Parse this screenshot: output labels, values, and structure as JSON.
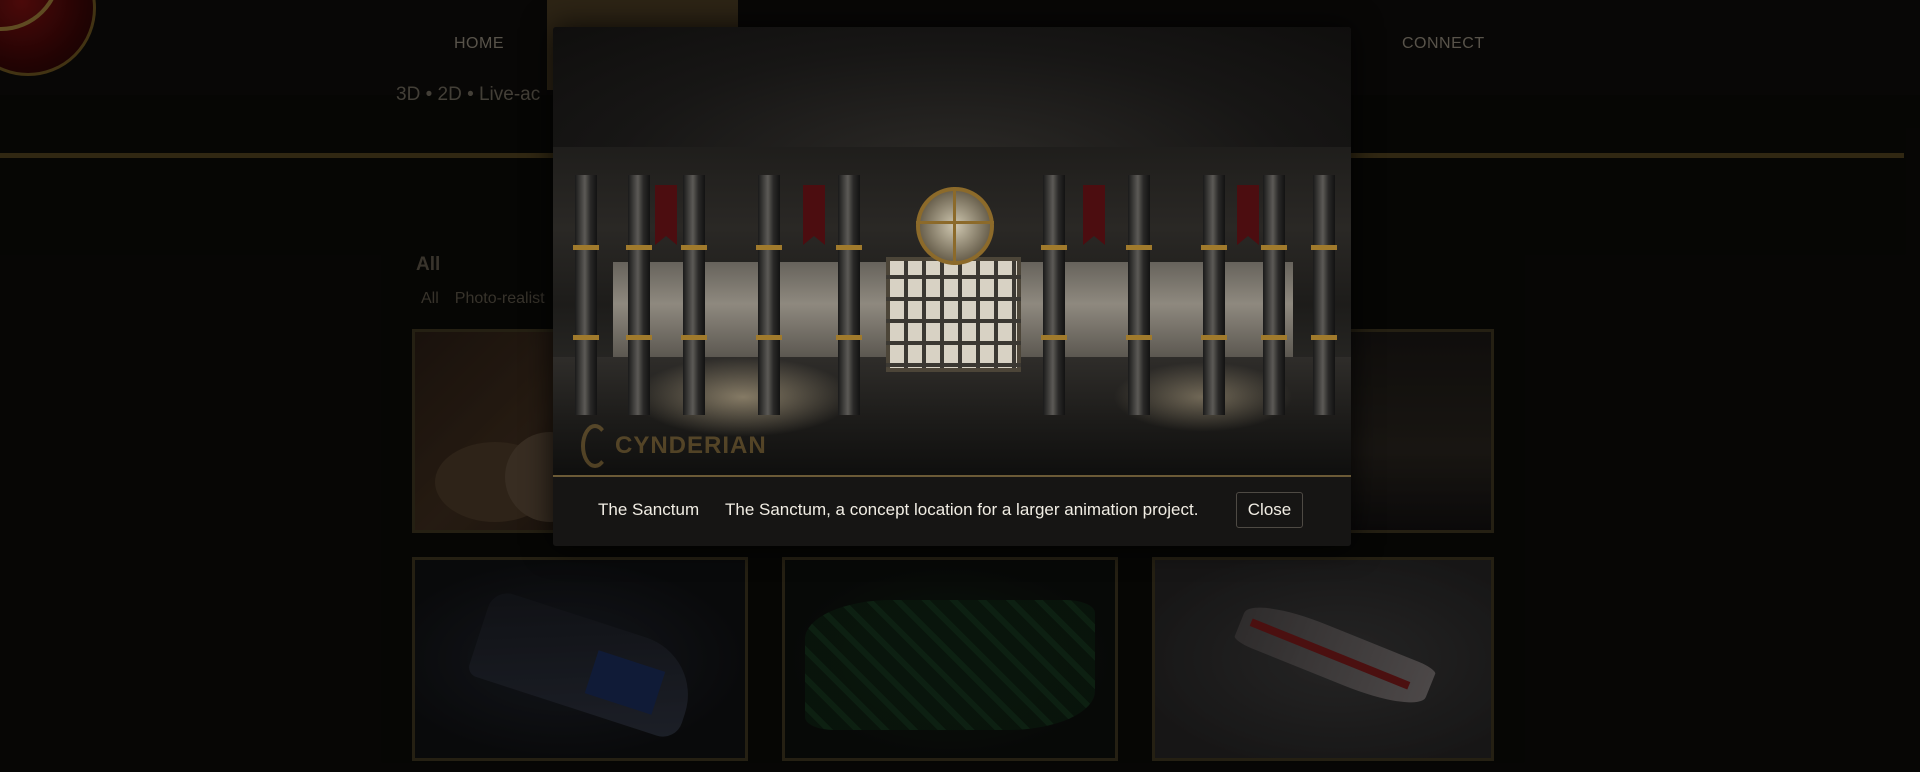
{
  "nav": {
    "home": "HOME",
    "connect": "CONNECT"
  },
  "tagline": "3D • 2D • Live-ac",
  "filters": {
    "heading": "All",
    "items": [
      "All",
      "Photo-realist"
    ]
  },
  "lightbox": {
    "watermark": "CYNDERIAN",
    "title": "The Sanctum",
    "caption": "The Sanctum, a concept location for a larger animation project.",
    "close_label": "Close"
  },
  "colors": {
    "background": "#0b0a08",
    "accent_gold": "#4e3f1e",
    "lightbox_bg": "#161514"
  }
}
